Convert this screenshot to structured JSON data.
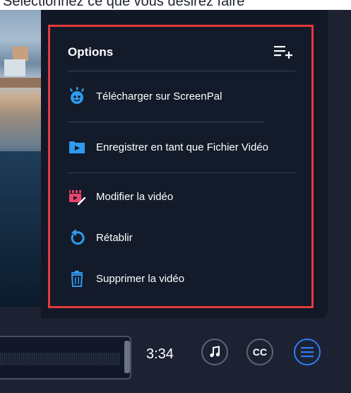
{
  "top_instruction": "Sélectionnez ce que vous désirez faire",
  "menu": {
    "title": "Options",
    "items": [
      {
        "label": "Télécharger sur ScreenPal",
        "icon": "screenpal-upload-icon"
      },
      {
        "label": "Enregistrer en tant que Fichier Vidéo",
        "icon": "video-file-icon"
      },
      {
        "label": "Modifier la vidéo",
        "icon": "edit-video-icon"
      },
      {
        "label": "Rétablir",
        "icon": "restore-icon"
      },
      {
        "label": "Supprimer la vidéo",
        "icon": "trash-icon"
      }
    ]
  },
  "toolbar": {
    "duration": "3:34",
    "music_icon": "music-note-icon",
    "captions_label": "CC",
    "menu_icon": "hamburger-menu-icon"
  },
  "colors": {
    "accent": "#2e7cf6",
    "highlight_border": "#e23b3b",
    "edit_icon": "#e8456b",
    "panel": "#121826"
  }
}
